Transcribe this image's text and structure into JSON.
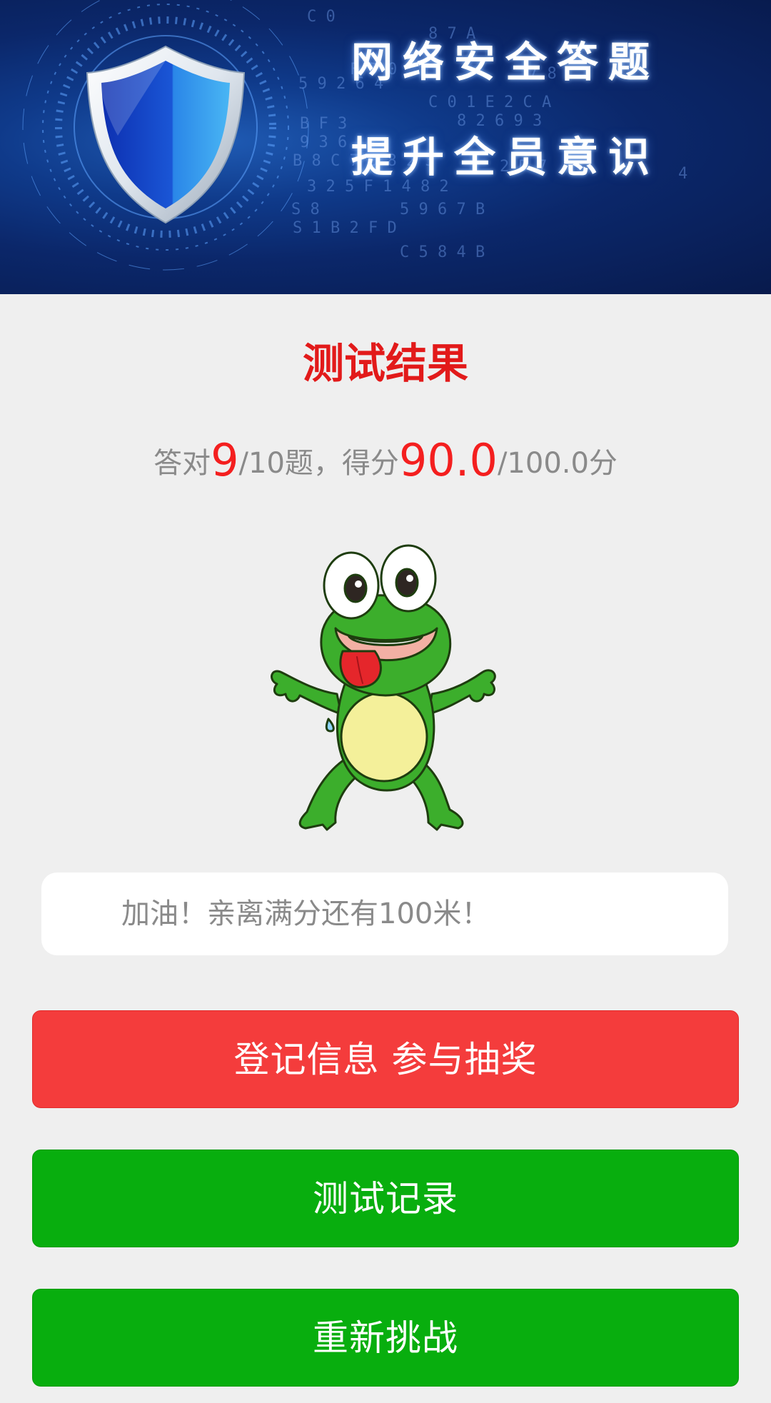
{
  "banner": {
    "line1": "网络安全答题",
    "line2": "提升全员意识",
    "background_color": "#0b276a"
  },
  "result": {
    "title": "测试结果",
    "title_color": "#e21a1a",
    "correct_prefix": "答对",
    "correct_count": "9",
    "question_total": "/10题，得分",
    "score": "90.0",
    "score_total": "/100.0分"
  },
  "mascot": {
    "icon": "frog-mascot-icon"
  },
  "message": {
    "text": "加油！亲离满分还有100米！"
  },
  "buttons": {
    "register": "登记信息 参与抽奖",
    "register_color": "#f43c3c",
    "records": "测试记录",
    "retry": "重新挑战",
    "green_color": "#08ae0e"
  }
}
